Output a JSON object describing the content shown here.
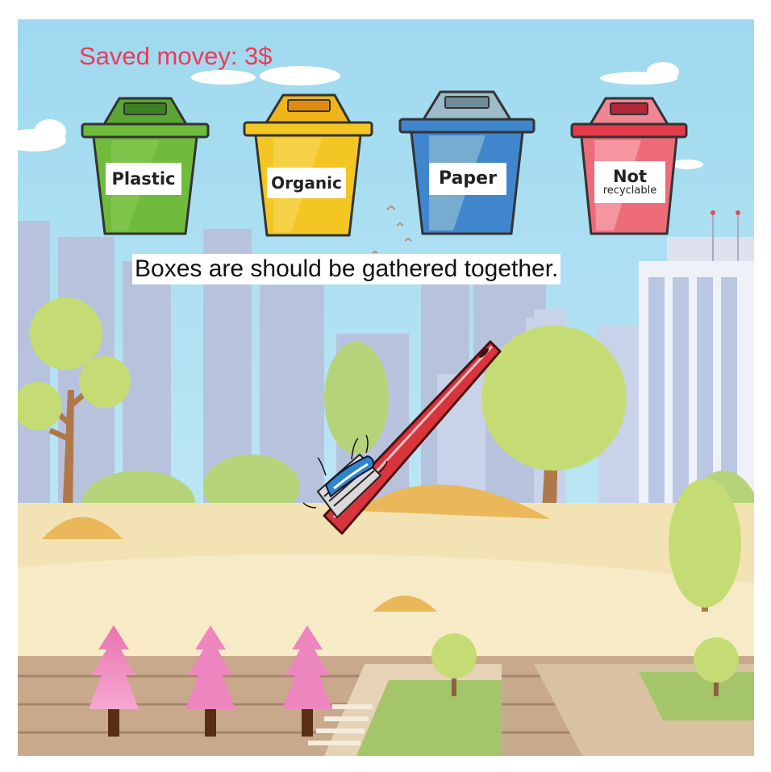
{
  "hud": {
    "saved_money": "Saved movey: 3$"
  },
  "bins": [
    {
      "label": "Plastic",
      "color": "#67b33a"
    },
    {
      "label": "Organic",
      "color": "#f2c21e"
    },
    {
      "label": "Paper",
      "color": "#3f86cc"
    },
    {
      "label_main": "Not",
      "label_sub": "recyclable",
      "color": "#ee6b7a"
    }
  ],
  "hint": "Boxes are should be gathered together.",
  "item": {
    "icon": "toothbrush-icon",
    "color": "#d7343b"
  },
  "decor": {
    "sky": "#a8ddf0",
    "ground": "#f3e3b4",
    "pink_trees": "#e878b4"
  }
}
